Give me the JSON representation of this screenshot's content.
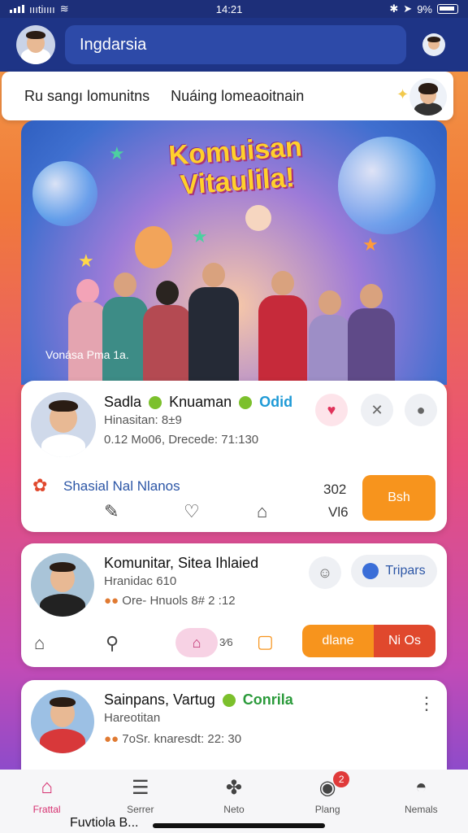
{
  "status_bar": {
    "carrier": "ıııtiıııı",
    "time": "14:21",
    "battery": "9%"
  },
  "header": {
    "search_text": "Ingdarsia"
  },
  "tabs": [
    "Ru sangı lomunitns",
    "Nuáing lomeaoitnain"
  ],
  "banner": {
    "title_line1": "Komuisan",
    "title_line2": "Vitaulila!",
    "caption": "Vonása Pma 1a."
  },
  "cards": [
    {
      "name": "Sadla",
      "name2": "Knuaman",
      "badge": "Odid",
      "line1": "Hinasitan: 8±9",
      "line2": "0.12 Mo06, Drecede: 71:130",
      "community": "Shasial Nal Nlanos",
      "stat1": "302",
      "stat2": "Vl6",
      "action": "Bsh"
    },
    {
      "title": "Komunitar, Sitea Ihlaied",
      "line1": "Hranidac 610",
      "line2": "Ore- Hnuols 8# 2 :12",
      "pill": "Tripars",
      "count": "3⁄6",
      "action1": "dlane",
      "action2": "Ni Os"
    },
    {
      "title": "Sainpans, Vartug",
      "badge": "Conrila",
      "line1": "Hareotitan",
      "line2": "7oSr. knaresdt: 22: 30"
    }
  ],
  "bottom_nav": [
    {
      "label": "Frattal",
      "icon": "home-icon",
      "active": true
    },
    {
      "label": "Serrer",
      "icon": "list-icon"
    },
    {
      "label": "Neto",
      "icon": "apps-icon"
    },
    {
      "label": "Plang",
      "icon": "chat-icon",
      "badge": "2"
    },
    {
      "label": "Nemals",
      "icon": "profile-icon"
    }
  ],
  "peek": {
    "text": "Fuvtiola B..."
  },
  "colors": {
    "header": "#1e3486",
    "accent": "#f7941d",
    "active_nav": "#d62f6f"
  }
}
